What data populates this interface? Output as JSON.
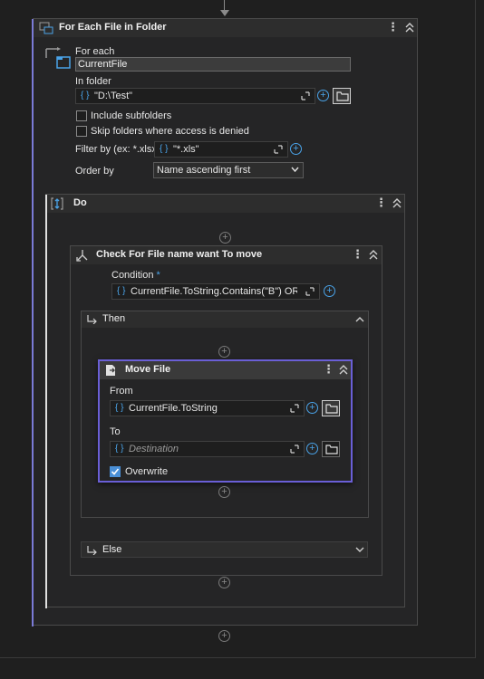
{
  "foreach": {
    "title": "For Each File in Folder",
    "for_each_label": "For each",
    "current_item": "CurrentFile",
    "in_folder_label": "In folder",
    "folder_value": "\"D:\\Test\"",
    "include_subfolders_label": "Include subfolders",
    "include_subfolders_checked": false,
    "skip_folders_label": "Skip folders where access is denied",
    "skip_folders_checked": false,
    "filter_label": "Filter by (ex: *.xlsx)",
    "filter_value": "\"*.xls\"",
    "order_label": "Order by",
    "order_value": "Name ascending first"
  },
  "do": {
    "title": "Do"
  },
  "ifblock": {
    "title": "Check For File name want To move",
    "condition_label": "Condition",
    "required_marker": "*",
    "condition_value": "CurrentFile.ToString.Contains(\"B\") OR Curr",
    "then_label": "Then",
    "else_label": "Else"
  },
  "movefile": {
    "title": "Move File",
    "from_label": "From",
    "from_value": "CurrentFile.ToString",
    "to_label": "To",
    "to_placeholder": "Destination",
    "overwrite_label": "Overwrite",
    "overwrite_checked": true
  },
  "icons": {
    "menu": "⋮",
    "add": "+",
    "curly": "{ }"
  },
  "colors": {
    "accent_blue": "#4aa3e8",
    "selection_purple": "#6a5fd6",
    "container_bar": "#7b7bd6"
  }
}
